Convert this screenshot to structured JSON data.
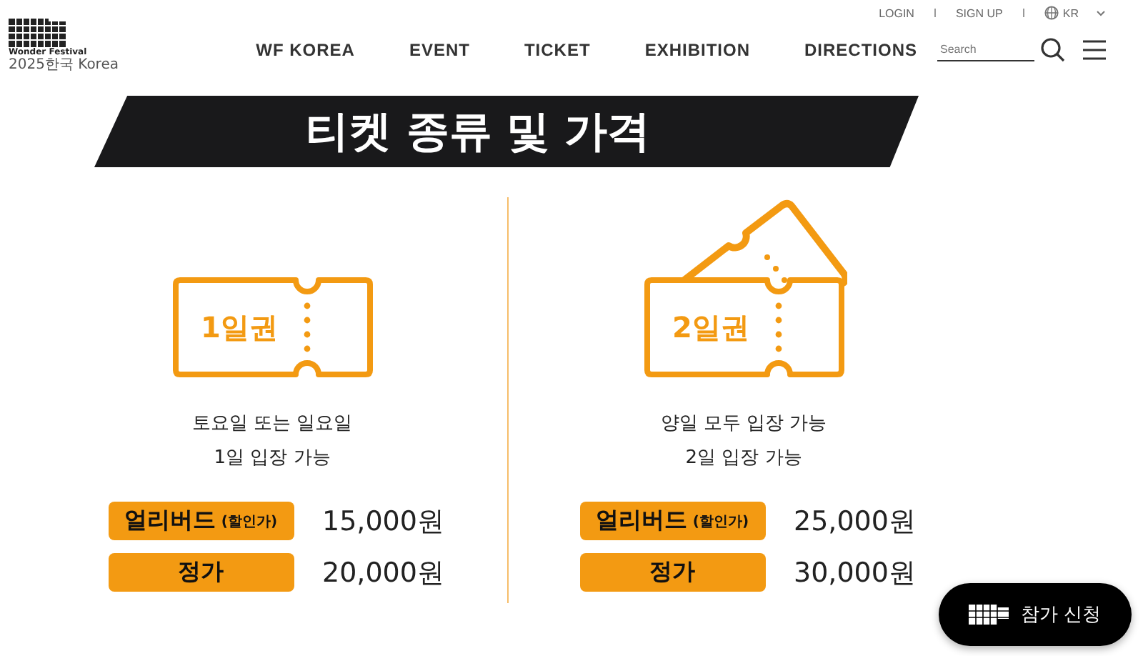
{
  "logo": {
    "line1": "Wonder Festival",
    "line2": "2025한국 Korea"
  },
  "top_links": [
    "LOGIN",
    "SIGN UP"
  ],
  "language": "KR",
  "nav": [
    "WF KOREA",
    "EVENT",
    "TICKET",
    "EXHIBITION",
    "DIRECTIONS"
  ],
  "search": {
    "placeholder": "Search"
  },
  "title": "티켓 종류 및 가격",
  "tickets": [
    {
      "kind": "single",
      "label": "1일권",
      "lines": [
        "토요일 또는 일요일",
        "1일 입장 가능"
      ],
      "prices": [
        {
          "label": "얼리버드",
          "note": "(할인가)",
          "amount": "15,000원"
        },
        {
          "label": "정가",
          "amount": "20,000원"
        }
      ]
    },
    {
      "kind": "double",
      "label": "2일권",
      "lines": [
        "양일 모두 입장 가능",
        "2일 입장 가능"
      ],
      "prices": [
        {
          "label": "얼리버드",
          "note": "(할인가)",
          "amount": "25,000원"
        },
        {
          "label": "정가",
          "amount": "30,000원"
        }
      ]
    }
  ],
  "apply_button": "참가 신청"
}
